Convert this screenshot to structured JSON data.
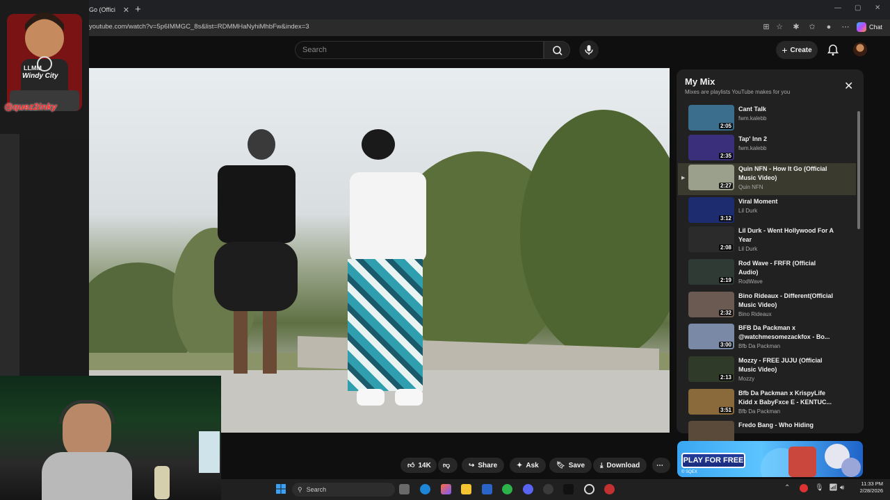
{
  "browser": {
    "tab_title": "Go (Offici",
    "url": "youtube.com/watch?v=5p6IMMGC_8s&list=RDMMHaNyhiMhbFw&index=3",
    "chat_label": "Chat"
  },
  "header": {
    "search_placeholder": "Search",
    "create_label": "Create"
  },
  "actions": {
    "likes": "14K",
    "share": "Share",
    "ask": "Ask",
    "save": "Save",
    "download": "Download"
  },
  "playlist": {
    "title": "My Mix",
    "subtitle": "Mixes are playlists YouTube makes for you",
    "items": [
      {
        "title": "Cant Talk",
        "channel": "fwm.kalebb",
        "duration": "2:05",
        "active": false,
        "thumb": "#3b6e8c"
      },
      {
        "title": "Tap' Inn 2",
        "channel": "fwm.kalebb",
        "duration": "2:35",
        "active": false,
        "thumb": "#3a2f7a"
      },
      {
        "title": "Quin NFN - How It Go (Official Music Video)",
        "channel": "Quin NFN",
        "duration": "2:27",
        "active": true,
        "thumb": "#9aa08c"
      },
      {
        "title": "Viral Moment",
        "channel": "Lil Durk",
        "duration": "3:12",
        "active": false,
        "thumb": "#1c2c6e"
      },
      {
        "title": "Lil Durk - Went Hollywood For A Year",
        "channel": "Lil Durk",
        "duration": "2:08",
        "active": false,
        "thumb": "#2b2b2b"
      },
      {
        "title": "Rod Wave - FRFR (Official Audio)",
        "channel": "RodWave",
        "duration": "2:19",
        "active": false,
        "thumb": "#2e3a33"
      },
      {
        "title": "Bino Rideaux - Different(Official Music Video)",
        "channel": "Bino Rideaux",
        "duration": "2:32",
        "active": false,
        "thumb": "#6b5a52"
      },
      {
        "title": "BFB Da Packman x @watchmesomezackfox - Bo...",
        "channel": "Bfb Da Packman",
        "duration": "3:00",
        "active": false,
        "thumb": "#7a8aa6"
      },
      {
        "title": "Mozzy - FREE JUJU (Official Music Video)",
        "channel": "Mozzy",
        "duration": "2:13",
        "active": false,
        "thumb": "#2f3a28"
      },
      {
        "title": "Bfb Da Packman x KrispyLife Kidd x BabyFxce E - KENTUC...",
        "channel": "Bfb Da Packman",
        "duration": "3:51",
        "active": false,
        "thumb": "#8a6a3a"
      },
      {
        "title": "Fredo Bang - Who Hiding",
        "channel": "",
        "duration": "",
        "active": false,
        "thumb": "#5a4a3a"
      }
    ]
  },
  "ad": {
    "button": "PLAY FOR FREE",
    "brand": "© SQEX"
  },
  "overlay": {
    "logo_line1": "LLMM",
    "logo_line2": "Windy City",
    "logo_handle": "@quez2inky"
  },
  "taskbar": {
    "search_placeholder": "Search",
    "time": "11:33 PM",
    "date": "2/28/2026"
  },
  "colors": {
    "accent_red": "#ff0000",
    "yt_bg": "#0f0f0f",
    "panel": "#212121"
  }
}
